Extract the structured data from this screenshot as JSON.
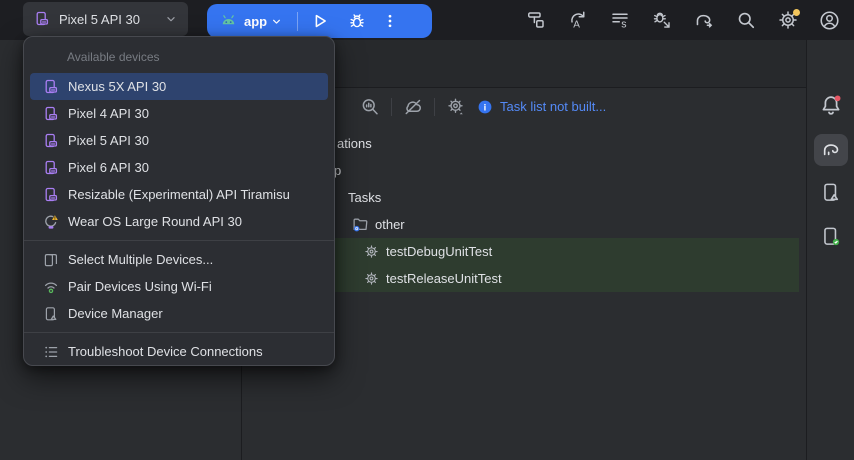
{
  "toolbar": {
    "device_selector": {
      "label": "Pixel 5 API 30",
      "icon": "virtual-device-icon"
    },
    "run_pill": {
      "config_label": "app",
      "icons": [
        "android-head-icon",
        "run-icon",
        "debug-icon",
        "more-options-icon"
      ]
    },
    "right_actions": [
      "build-hammer-icon",
      "apply-changes-icon",
      "apply-code-changes-icon",
      "attach-debugger-icon",
      "gradle-sync-icon",
      "search-everywhere-icon",
      "settings-icon",
      "profile-avatar-icon"
    ],
    "settings_badge_color": "#f2c55c"
  },
  "device_menu": {
    "header": "Available devices",
    "devices": [
      {
        "label": "Nexus 5X API 30",
        "icon": "virtual-device-icon",
        "selected": true
      },
      {
        "label": "Pixel 4 API 30",
        "icon": "virtual-device-icon",
        "selected": false
      },
      {
        "label": "Pixel 5 API 30",
        "icon": "virtual-device-icon",
        "selected": false
      },
      {
        "label": "Pixel 6 API 30",
        "icon": "virtual-device-icon",
        "selected": false
      },
      {
        "label": "Resizable (Experimental) API Tiramisu",
        "icon": "virtual-device-icon",
        "selected": false
      },
      {
        "label": "Wear OS Large Round API 30",
        "icon": "wear-device-warning-icon",
        "selected": false
      }
    ],
    "actions": [
      {
        "label": "Select Multiple Devices...",
        "icon": "multiple-devices-icon"
      },
      {
        "label": "Pair Devices Using Wi-Fi",
        "icon": "wifi-pair-icon"
      },
      {
        "label": "Device Manager",
        "icon": "device-manager-icon"
      }
    ],
    "footer_actions": [
      {
        "label": "Troubleshoot Device Connections",
        "icon": "troubleshoot-list-icon"
      }
    ]
  },
  "gradle_panel": {
    "toolbar_icons": [
      "execute-task-icon",
      "offline-mode-icon",
      "gradle-settings-icon"
    ],
    "status": {
      "icon": "info-icon",
      "message": "Task list not built..."
    },
    "tree": [
      {
        "label": "ations",
        "type": "clipped-text"
      },
      {
        "label": "p",
        "type": "clipped-text"
      },
      {
        "label": "Tasks",
        "type": "node"
      },
      {
        "label": "other",
        "type": "folder",
        "icon": "folder-gear-icon"
      },
      {
        "label": "testDebugUnitTest",
        "type": "task",
        "icon": "task-gear-icon",
        "highlighted": true
      },
      {
        "label": "testReleaseUnitTest",
        "type": "task",
        "icon": "task-gear-icon",
        "highlighted": true
      }
    ]
  },
  "right_stripe": {
    "icons": [
      "notifications-bell-icon",
      "gradle-tool-icon",
      "device-manager-tool-icon",
      "running-devices-tool-icon"
    ],
    "selected": "gradle-tool-icon",
    "notification_badge_color": "#e55765"
  },
  "colors": {
    "accent_blue": "#3574f0",
    "link_blue": "#548af7",
    "selection_blue": "#2e436e",
    "task_highlight_green": "#2e3c2f",
    "device_purple": "#a97ef3",
    "android_teal": "#63c5a4",
    "warning_yellow": "#f0b732",
    "pair_green": "#58b75c"
  }
}
